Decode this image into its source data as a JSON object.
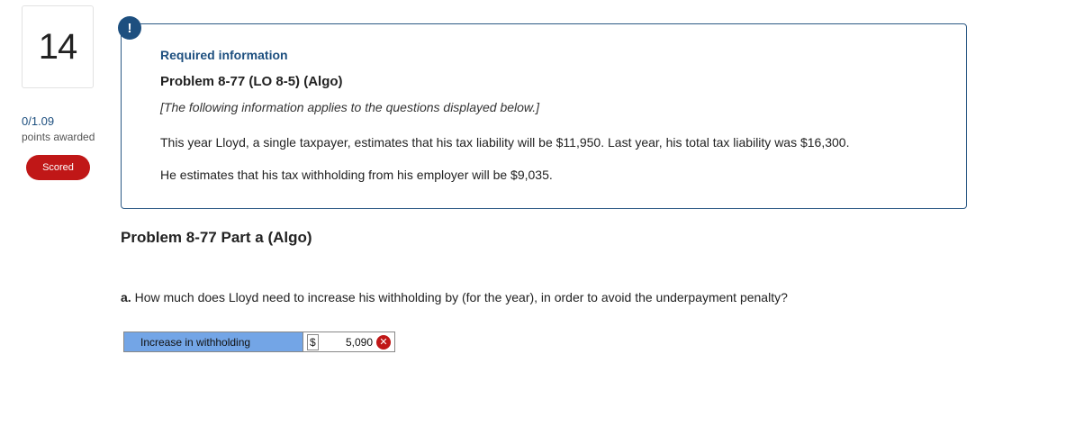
{
  "question": {
    "number": "14",
    "score": "0/1.09",
    "points_label": "points awarded",
    "status_badge": "Scored"
  },
  "alert": {
    "icon_glyph": "!",
    "icon": "exclamation-icon"
  },
  "info": {
    "required_title": "Required information",
    "problem_title": "Problem 8-77 (LO 8-5) (Algo)",
    "note": "[The following information applies to the questions displayed below.]",
    "line1": "This year Lloyd, a single taxpayer, estimates that his tax liability will be $11,950. Last year, his total tax liability was $16,300.",
    "line2": "He estimates that his tax withholding from his employer will be $9,035."
  },
  "part": {
    "title": "Problem 8-77 Part a (Algo)",
    "question_prefix": "a.",
    "question_text": " How much does Lloyd need to increase his withholding by (for the year), in order to avoid the underpayment penalty?"
  },
  "answer": {
    "label": "Increase in withholding",
    "currency": "$",
    "value": "5,090",
    "status_icon": "x-circle-icon",
    "status_glyph": "✕"
  },
  "colors": {
    "brand_blue": "#1d4f7f",
    "scored_red": "#c01717",
    "label_cell_blue": "#73a5e6"
  }
}
